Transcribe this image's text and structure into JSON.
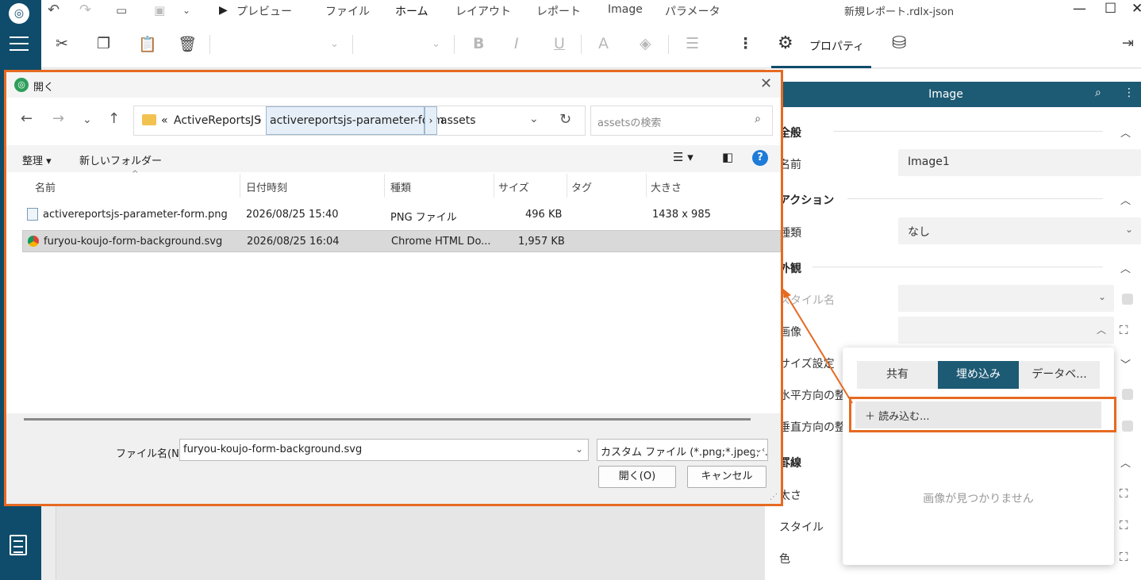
{
  "app": {
    "window_title": "新規レポート.rdlx-json",
    "menu": [
      "プレビュー",
      "ファイル",
      "ホーム",
      "レイアウト",
      "レポート",
      "Image",
      "パラメータ"
    ],
    "active_menu": "ホーム"
  },
  "toolbar": {
    "properties_label": "プロパティ"
  },
  "properties": {
    "header_title": "Image",
    "sections": {
      "general": "全般",
      "action": "アクション",
      "appearance": "外観",
      "border": "罫線"
    },
    "labels": {
      "name": "名前",
      "action_type": "種類",
      "style_name": "スタイル名",
      "image": "画像",
      "size_mode": "サイズ設定",
      "h_align": "水平方向の整",
      "v_align": "垂直方向の整",
      "width": "太さ",
      "style": "スタイル",
      "color": "色"
    },
    "values": {
      "name": "Image1",
      "action_type": "なし"
    }
  },
  "image_popup": {
    "tabs": [
      "共有",
      "埋め込み",
      "データベ..."
    ],
    "active_tab": "埋め込み",
    "load_button": "読み込む...",
    "empty_text": "画像が見つかりません"
  },
  "dialog": {
    "title": "開く",
    "address": {
      "root": "«",
      "segments": [
        "ActiveReportsJS",
        "activereportsjs-parameter-form",
        "assets"
      ]
    },
    "search_placeholder": "assetsの検索",
    "commands": {
      "organize": "整理 ▾",
      "new_folder": "新しいフォルダー"
    },
    "columns": [
      "名前",
      "日付時刻",
      "種類",
      "サイズ",
      "タグ",
      "大きさ"
    ],
    "files": [
      {
        "name": "activereportsjs-parameter-form.png",
        "date": "2026/08/25 15:40",
        "type": "PNG ファイル",
        "size": "496 KB",
        "tag": "",
        "dims": "1438 x 985",
        "selected": false
      },
      {
        "name": "furyou-koujo-form-background.svg",
        "date": "2026/08/25 16:04",
        "type": "Chrome HTML Do...",
        "size": "1,957 KB",
        "tag": "",
        "dims": "",
        "selected": true
      }
    ],
    "filename_label": "ファイル名(N):",
    "filename_value": "furyou-koujo-form-background.svg",
    "filetype_value": "カスタム ファイル (*.png;*.jpeg;*.jpg",
    "open_button": "開く(O)",
    "cancel_button": "キャンセル"
  },
  "colors": {
    "accent": "#1d5a74",
    "highlight": "#e66a21",
    "sidebar": "#0f4c6b"
  }
}
